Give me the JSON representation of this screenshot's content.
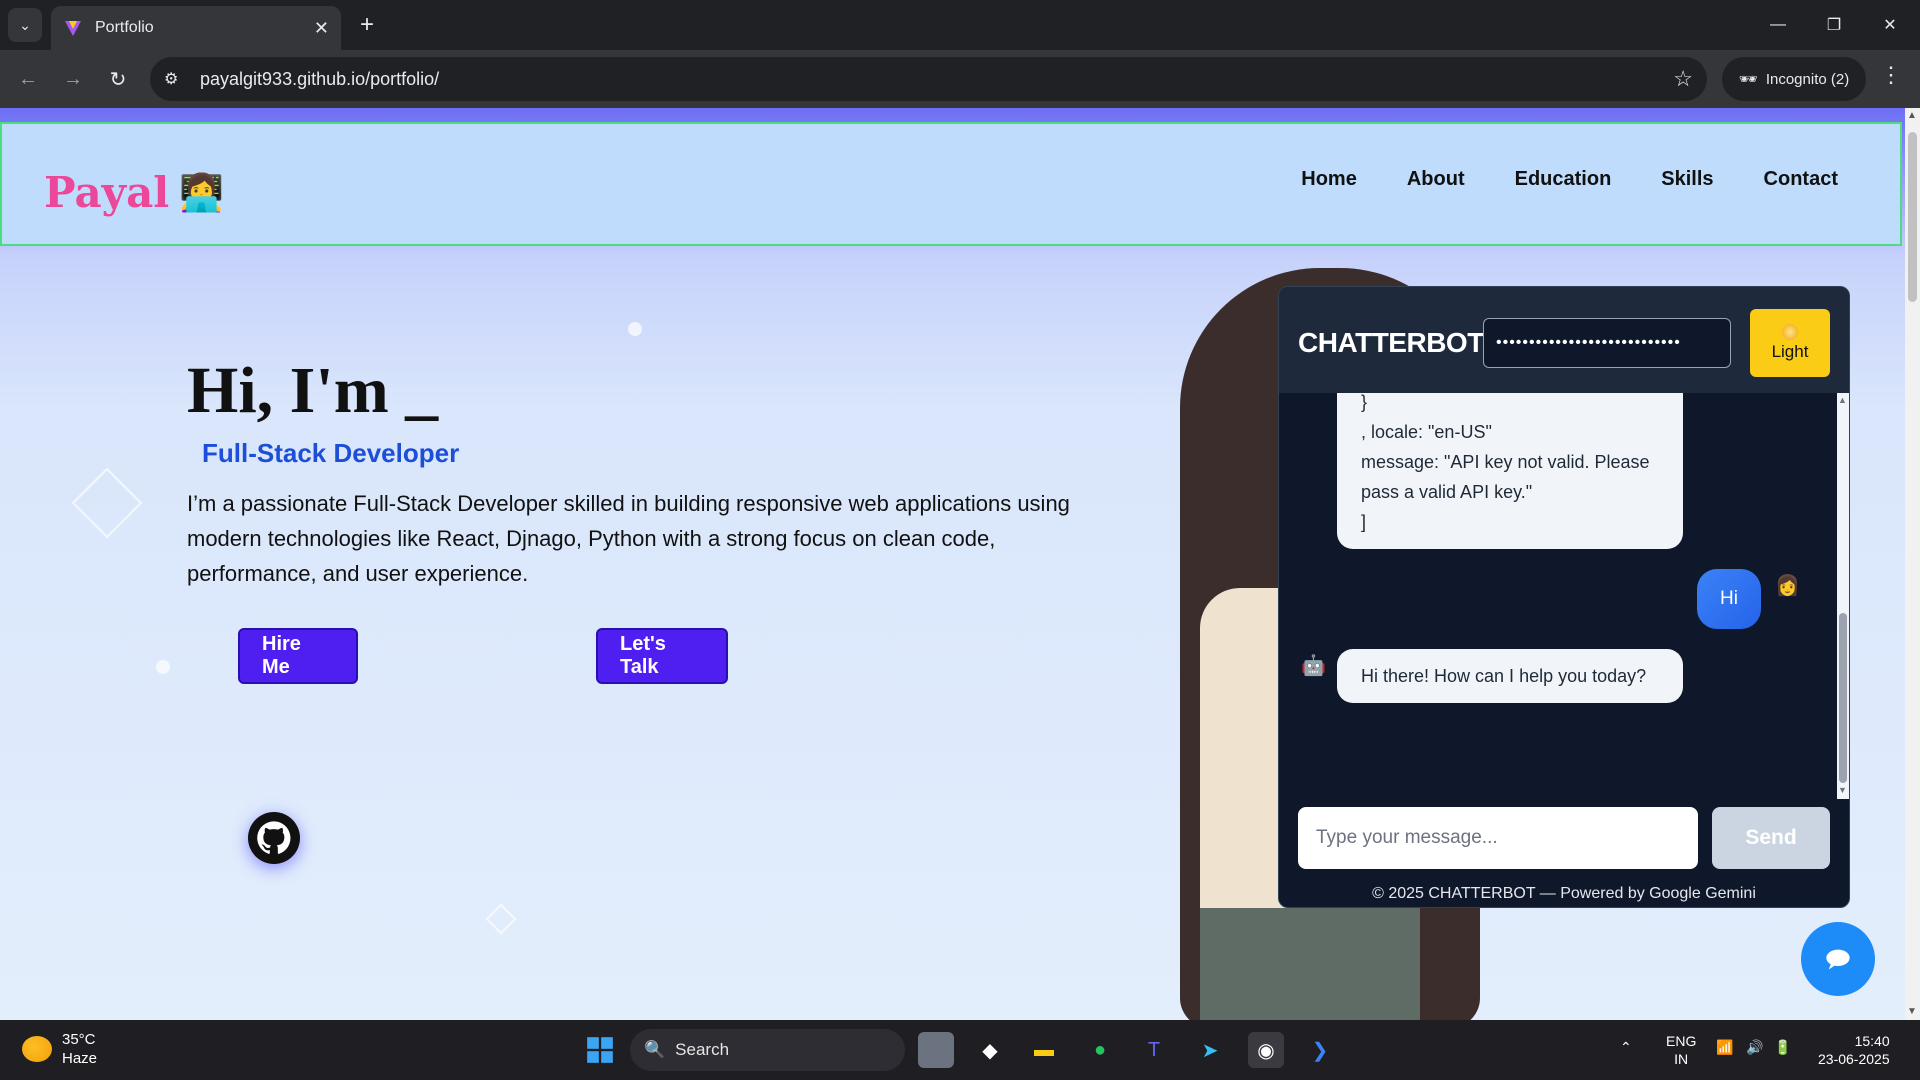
{
  "browser": {
    "tab_title": "Portfolio",
    "url": "payalgit933.github.io/portfolio/",
    "profile": "Incognito (2)"
  },
  "site": {
    "brand": "Payal",
    "brand_emoji": "👩‍💻",
    "nav": [
      "Home",
      "About",
      "Education",
      "Skills",
      "Contact"
    ],
    "hero_title": "Hi, I'm _",
    "hero_subtitle": "Full-Stack Developer",
    "hero_description": "I’m a passionate Full-Stack Developer skilled in building responsive web applications using modern technologies like React, Djnago, Python with a strong focus on clean code, performance, and user experience.",
    "hire_button": "Hire Me",
    "talk_button": "Let's Talk"
  },
  "chatbot": {
    "title": "CHATTERBOT",
    "api_key_value": "••••••••••••••••••••••••••••",
    "theme_button": "Light",
    "messages": {
      "error_partial": "}\n, locale: \"en-US\"\nmessage: \"API key not valid. Please pass a valid API key.\"\n]",
      "user_message": "Hi",
      "bot_reply": "Hi there! How can I help you today?"
    },
    "input_placeholder": "Type your message...",
    "send_label": "Send",
    "footer": "© 2025 CHATTERBOT — Powered by Google Gemini"
  },
  "taskbar": {
    "weather_temp": "35°C",
    "weather_desc": "Haze",
    "search_label": "Search",
    "lang_line1": "ENG",
    "lang_line2": "IN",
    "time": "15:40",
    "date": "23-06-2025"
  },
  "colors": {
    "brand_pink": "#ec4899",
    "accent_blue": "#1d4ed8",
    "button_purple": "#4f1ff2",
    "chat_bg": "#0f172a",
    "theme_yellow": "#facc15"
  }
}
